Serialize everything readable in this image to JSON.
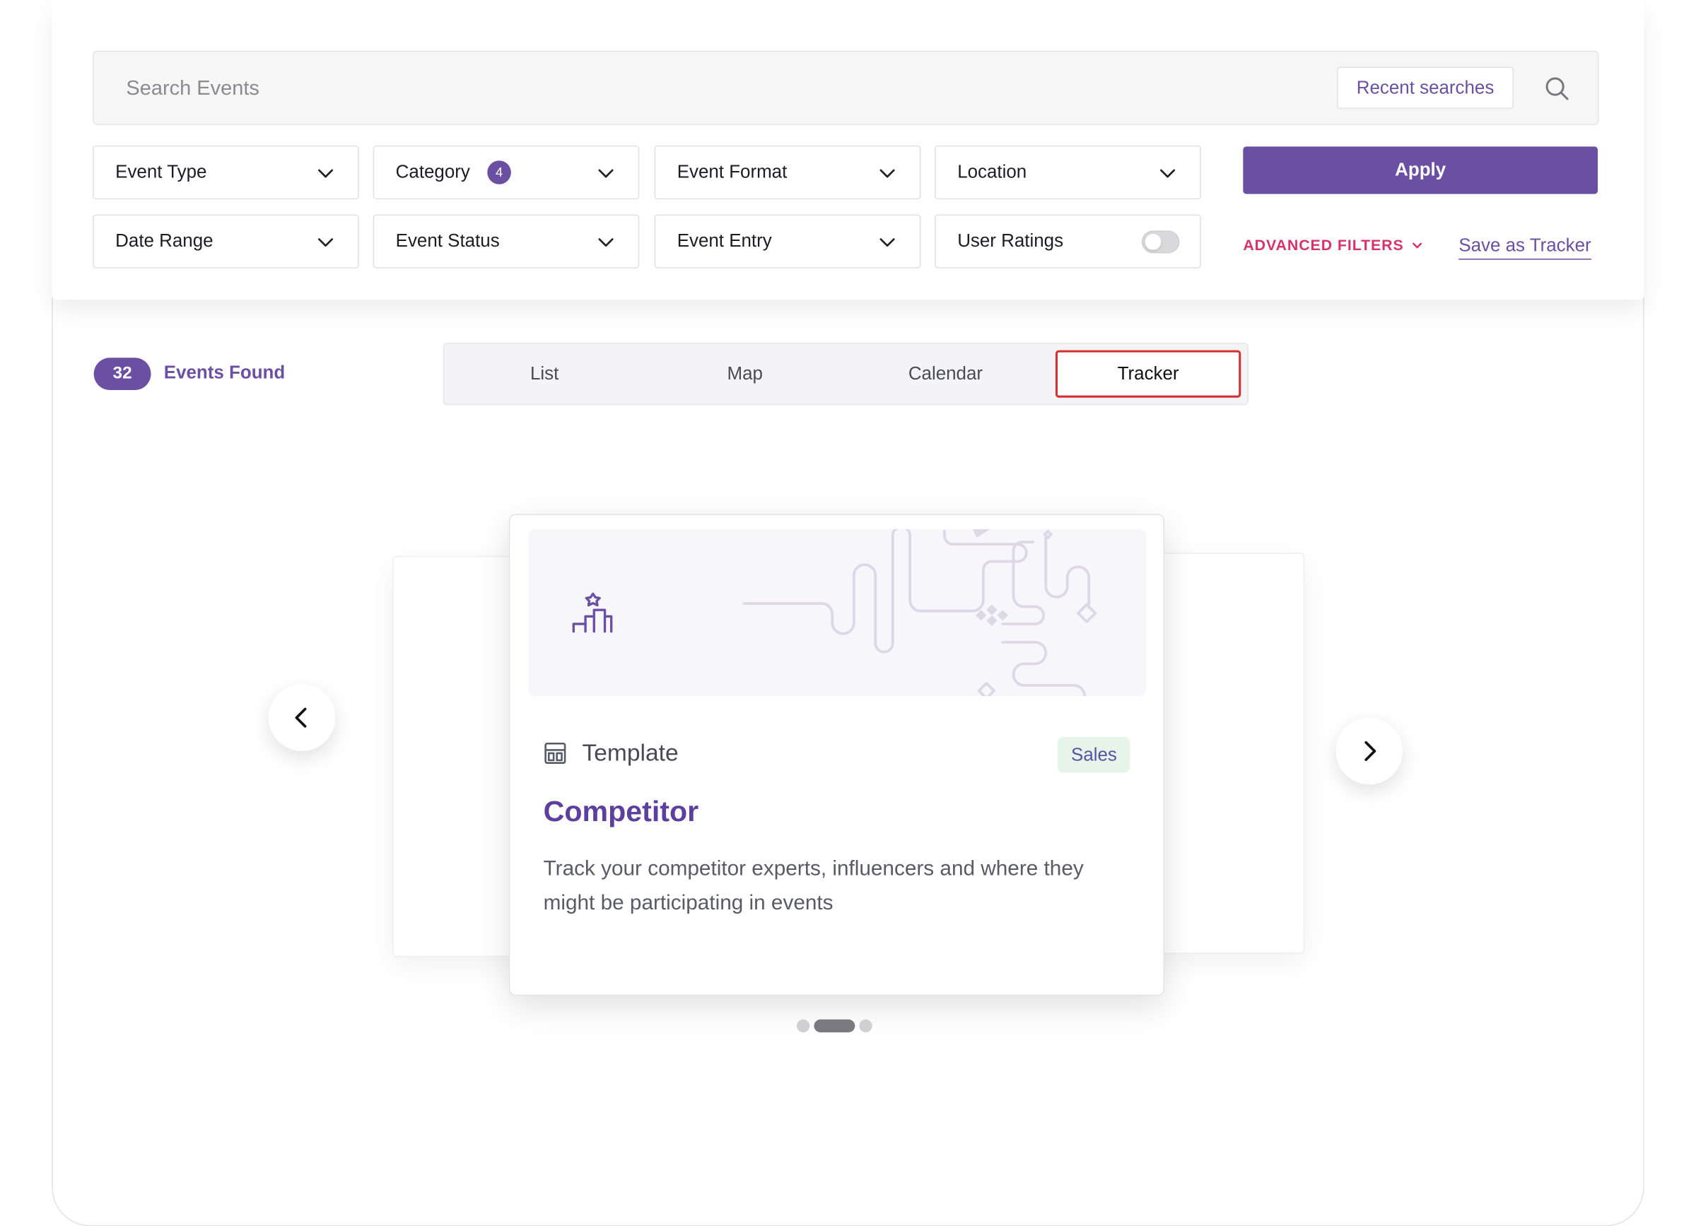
{
  "search": {
    "placeholder": "Search Events",
    "value": "",
    "recent_label": "Recent searches",
    "icon": "search-icon"
  },
  "filters": {
    "row1": [
      {
        "label": "Event Type"
      },
      {
        "label": "Category",
        "badge": "4"
      },
      {
        "label": "Event Format"
      },
      {
        "label": "Location"
      }
    ],
    "row2": [
      {
        "label": "Date Range"
      },
      {
        "label": "Event Status"
      },
      {
        "label": "Event Entry"
      },
      {
        "label": "User Ratings",
        "toggle_on": false
      }
    ],
    "apply_label": "Apply",
    "advanced_label": "ADVANCED FILTERS",
    "save_tracker_label": "Save as Tracker"
  },
  "results": {
    "count": "32",
    "found_label": "Events Found"
  },
  "view_tabs": [
    {
      "label": "List",
      "active": false
    },
    {
      "label": "Map",
      "active": false
    },
    {
      "label": "Calendar",
      "active": false
    },
    {
      "label": "Tracker",
      "active": true
    }
  ],
  "card": {
    "kind_label": "Template",
    "tag": "Sales",
    "title": "Competitor",
    "description": "Track your competitor experts, influencers and where they might be participating in events"
  },
  "carousel": {
    "slide_count": 3,
    "active_slide": 2
  },
  "colors": {
    "accent": "#6a4fa3",
    "advanced": "#d6336c",
    "active_tab_border": "#d82e2e",
    "tag_bg": "#e6f4ea"
  }
}
